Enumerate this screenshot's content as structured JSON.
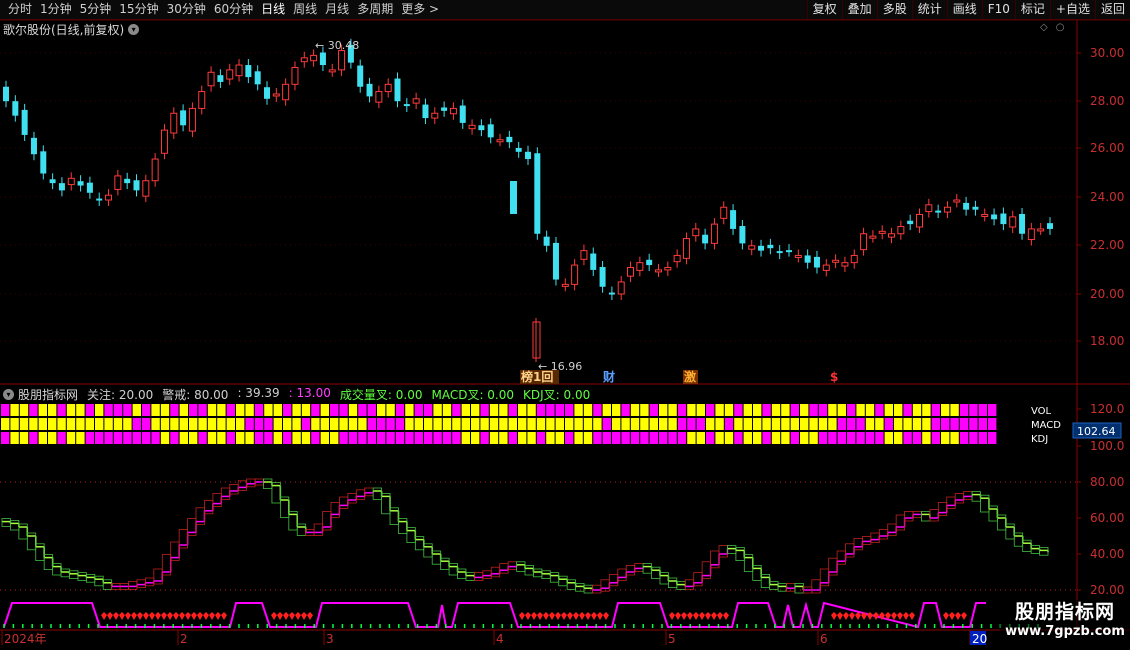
{
  "toolbar": {
    "periods": [
      "分时",
      "1分钟",
      "5分钟",
      "15分钟",
      "30分钟",
      "60分钟",
      "日线",
      "周线",
      "月线",
      "多周期",
      "更多 >"
    ],
    "active_index": 6,
    "buttons": [
      "复权",
      "叠加",
      "多股",
      "统计",
      "画线",
      "F10",
      "标记",
      "+自选",
      "返回"
    ]
  },
  "stock": {
    "title": "歌尔股份(日线,前复权)"
  },
  "price_axis": {
    "ticks": [
      "30.00",
      "28.00",
      "26.00",
      "24.00",
      "22.00",
      "20.00",
      "18.00"
    ]
  },
  "annotations": {
    "high": "30.48",
    "low": "16.96"
  },
  "event_markers": [
    {
      "label": "榜1回",
      "color": "#ffd28a",
      "bg": "#5a2800"
    },
    {
      "label": "财",
      "color": "#5aa0ff",
      "bg": ""
    },
    {
      "label": "激",
      "color": "#ffb030",
      "bg": "#7a3000"
    },
    {
      "label": "$",
      "color": "#ff3030",
      "bg": ""
    }
  ],
  "indicator": {
    "name": "股朋指标网",
    "items": [
      {
        "text": "关注: 20.00",
        "color": "#d0d0d0"
      },
      {
        "text": "警戒: 80.00",
        "color": "#d0d0d0"
      },
      {
        "text": ": 39.39",
        "color": "#d0d0d0"
      },
      {
        "text": ": 13.00",
        "color": "#ff40ff"
      },
      {
        "text": "成交量叉: 0.00",
        "color": "#60ff40"
      },
      {
        "text": "MACD叉: 0.00",
        "color": "#60ff40"
      },
      {
        "text": "KDJ叉: 0.00",
        "color": "#60ff40"
      }
    ],
    "row_labels": [
      "VOL",
      "MACD",
      "KDJ"
    ],
    "value_badge": "102.64",
    "axis_ticks": [
      "120.0",
      "100.0",
      "80.00",
      "60.00",
      "40.00",
      "20.00"
    ]
  },
  "date_axis": {
    "labels": [
      "2024年",
      "2",
      "3",
      "4",
      "5",
      "6",
      "20"
    ]
  },
  "watermark": {
    "title": "股朋指标网",
    "url": "www.7gpzb.com"
  },
  "colors": {
    "up": "#ff3b3b",
    "down": "#40e0f0",
    "magenta": "#ff00ff",
    "yellow": "#ffff00",
    "green": "#00ff40",
    "axis_red": "#8a0000"
  }
}
